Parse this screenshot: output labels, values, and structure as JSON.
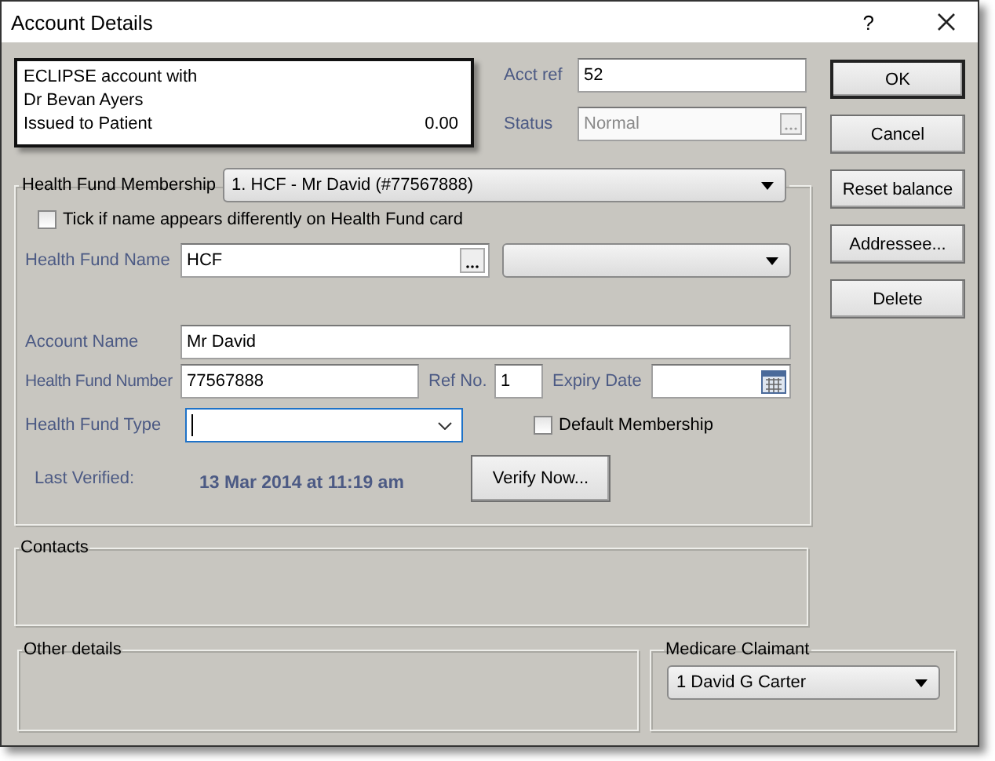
{
  "window": {
    "title": "Account Details",
    "help": "?"
  },
  "account_summary": {
    "lines": [
      "ECLIPSE account with",
      "Dr Bevan Ayers"
    ],
    "issued_label": "Issued to Patient",
    "balance": "0.00"
  },
  "acct_ref": {
    "label": "Acct ref",
    "value": "52"
  },
  "status": {
    "label": "Status",
    "value": "Normal",
    "disabled": true
  },
  "buttons": [
    {
      "label": "OK",
      "default": true
    },
    {
      "label": "Cancel",
      "default": false
    },
    {
      "label": "Reset balance",
      "default": false
    },
    {
      "label": "Addressee...",
      "default": false
    },
    {
      "label": "Delete",
      "default": false
    }
  ],
  "health_fund": {
    "label": "Health Fund Membership",
    "membership": "1. HCF - Mr David (#77567888)",
    "name_differs": {
      "label": "Tick if name appears differently on Health Fund card",
      "checked": false
    },
    "fund_name": {
      "label": "Health Fund Name",
      "value": "HCF"
    },
    "account_name": {
      "label": "Account Name",
      "value": "Mr David"
    },
    "fund_number": {
      "label": "Health Fund Number",
      "value": "77567888"
    },
    "ref_no": {
      "label": "Ref No.",
      "value": "1"
    },
    "expiry": {
      "label": "Expiry Date"
    },
    "fund_type": {
      "label": "Health Fund Type",
      "focused": true
    },
    "default_membership": {
      "label": "Default Membership",
      "checked": false
    },
    "last_verified": {
      "label": "Last Verified:",
      "value": "13 Mar 2014 at 11:19 am"
    },
    "verify_button": "Verify Now..."
  },
  "contacts": {
    "title": "Contacts"
  },
  "other_details": {
    "title": "Other details"
  },
  "medicare": {
    "title": "Medicare Claimant",
    "claimant": "1  David G Carter"
  }
}
